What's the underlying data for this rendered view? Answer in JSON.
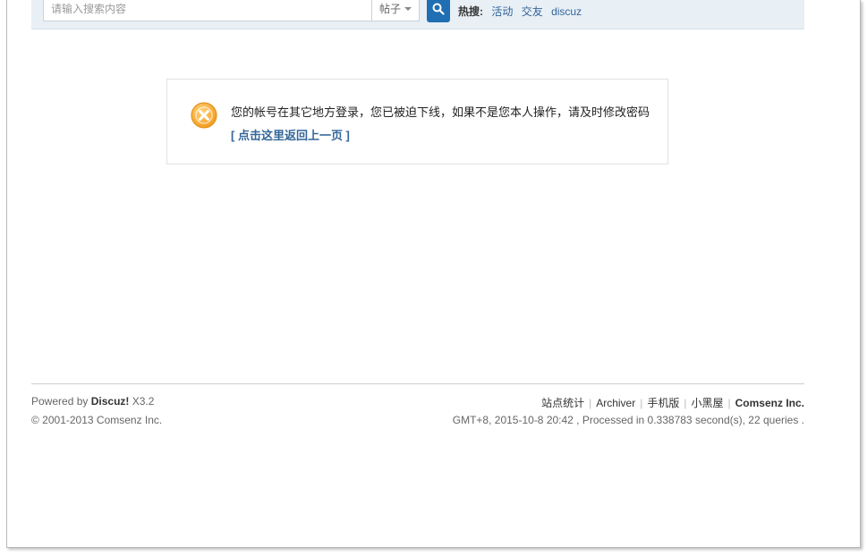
{
  "search": {
    "placeholder": "请输入搜索内容",
    "type_label": "帖子",
    "hot_label": "热搜:",
    "hot_links": [
      "活动",
      "交友",
      "discuz"
    ]
  },
  "alert": {
    "message": "您的帐号在其它地方登录，您已被迫下线，如果不是您本人操作，请及时修改密码",
    "back_link": "[ 点击这里返回上一页 ]",
    "icon": "error-x-icon",
    "icon_color": "#f5a623"
  },
  "footer": {
    "powered_prefix": "Powered by",
    "brand": "Discuz!",
    "version": "X3.2",
    "copyright": "© 2001-2013 Comsenz Inc.",
    "links": [
      "站点统计",
      "Archiver",
      "手机版",
      "小黑屋",
      "Comsenz Inc."
    ],
    "info": "GMT+8, 2015-10-8 20:42 , Processed in 0.338783 second(s), 22 queries ."
  },
  "colors": {
    "link": "#336699",
    "search_button": "#1f6fb2",
    "strip_bg": "#e8eff5"
  }
}
